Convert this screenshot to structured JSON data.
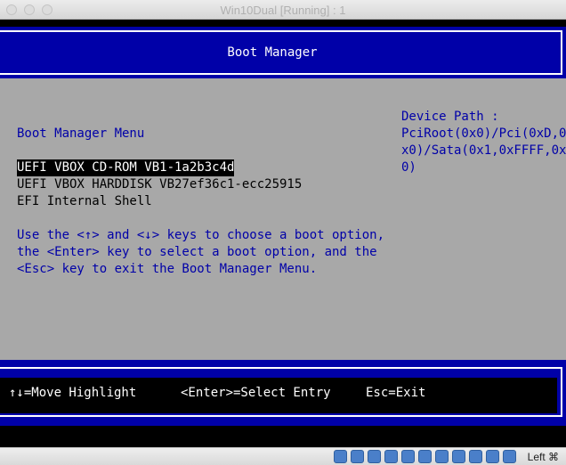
{
  "window": {
    "title": "Win10Dual [Running] : 1"
  },
  "header": {
    "title": "Boot Manager"
  },
  "menu": {
    "title": "Boot Manager Menu",
    "items": [
      {
        "label": "UEFI VBOX CD-ROM VB1-1a2b3c4d",
        "selected": true
      },
      {
        "label": "UEFI VBOX HARDDISK VB27ef36c1-ecc25915",
        "selected": false
      },
      {
        "label": "EFI Internal Shell",
        "selected": false
      }
    ],
    "help_lines": [
      "Use the <↑> and <↓> keys to choose a boot option,",
      "the <Enter> key to select a boot option, and the",
      "<Esc> key to exit the Boot Manager Menu."
    ]
  },
  "device_path": {
    "label": "Device Path :",
    "lines": [
      "PciRoot(0x0)/Pci(0xD,0",
      "x0)/Sata(0x1,0xFFFF,0x",
      "0)"
    ]
  },
  "footer": {
    "move": "↑↓=Move Highlight",
    "select": "<Enter>=Select Entry",
    "exit": "Esc=Exit"
  },
  "statusbar": {
    "icons": [
      "hard-disk-icon",
      "optical-drive-icon",
      "audio-icon",
      "network-icon",
      "usb-icon",
      "shared-folder-icon",
      "display-icon",
      "video-capture-icon",
      "cpu-icon",
      "mouse-integration-icon",
      "keyboard-capture-icon"
    ],
    "host_key": "Left ⌘"
  }
}
